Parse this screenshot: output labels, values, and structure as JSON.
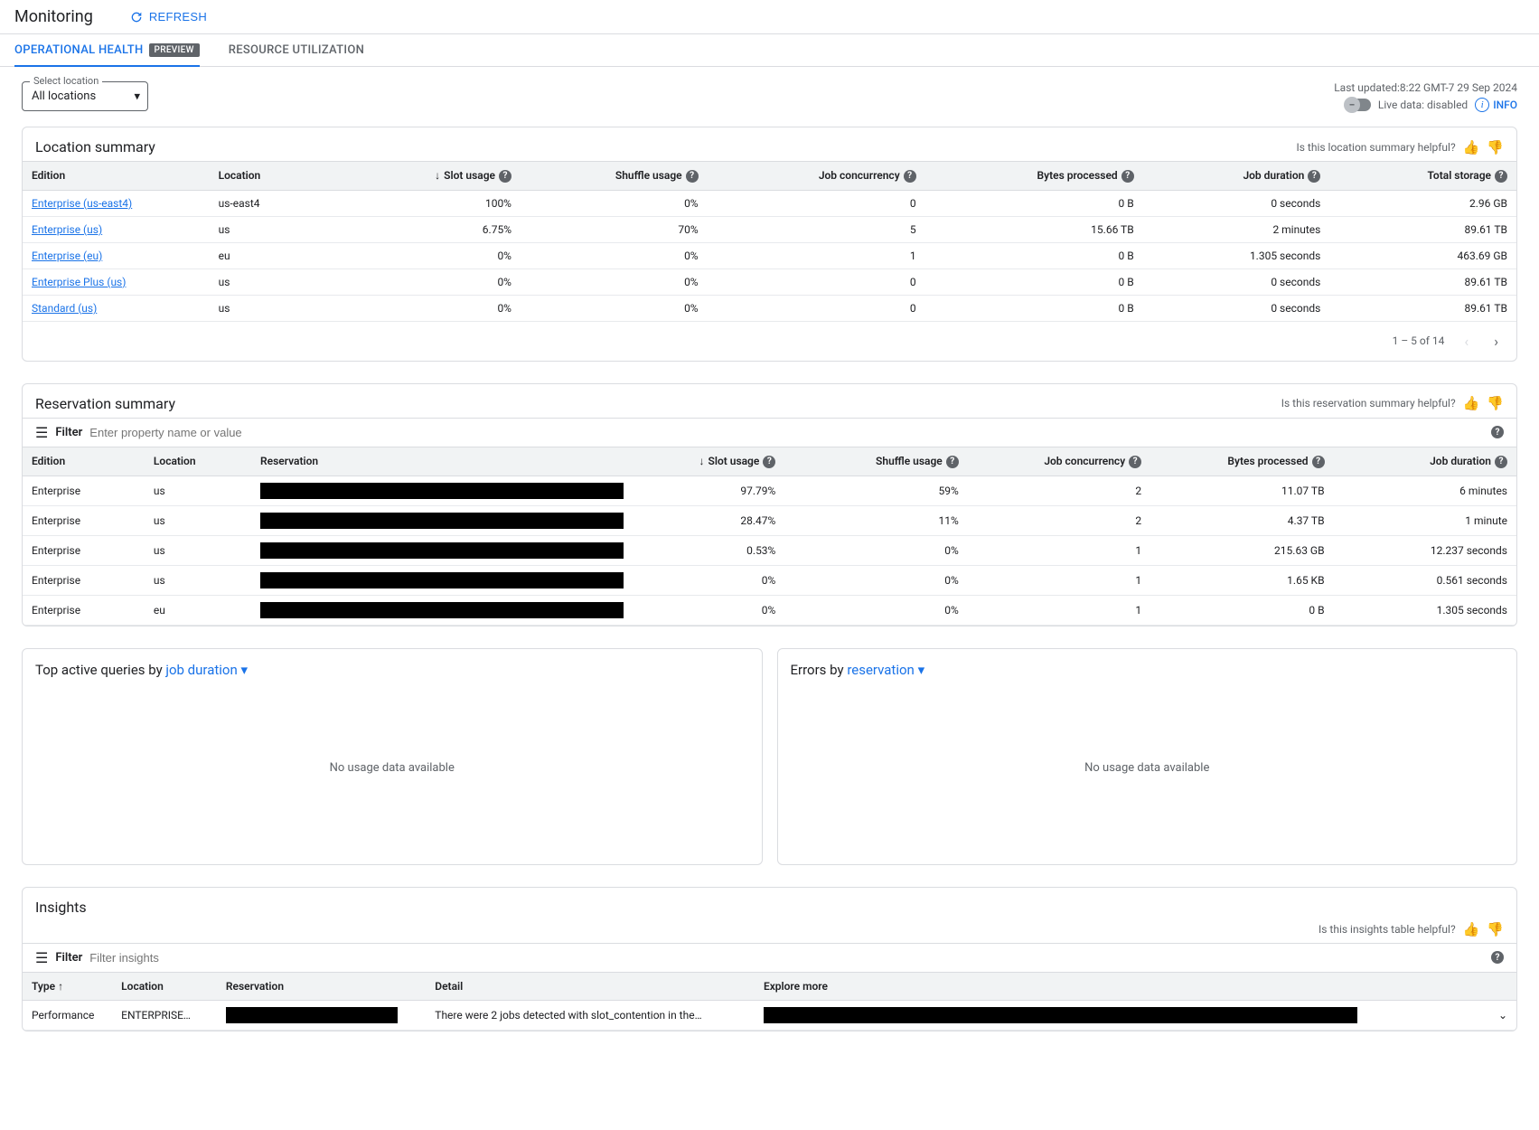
{
  "page_title": "Monitoring",
  "refresh_label": "REFRESH",
  "tabs": {
    "operational": "OPERATIONAL HEALTH",
    "preview_badge": "PREVIEW",
    "resource": "RESOURCE UTILIZATION"
  },
  "location_select": {
    "label": "Select location",
    "value": "All locations"
  },
  "last_updated_label": "Last updated:",
  "last_updated_value": "8:22 GMT-7 29 Sep 2024",
  "live_data_label": "Live data:",
  "live_data_status": "disabled",
  "info_label": "INFO",
  "location_summary": {
    "title": "Location summary",
    "helpful_prompt": "Is this location summary helpful?",
    "columns": {
      "edition": "Edition",
      "location": "Location",
      "slot_usage": "Slot usage",
      "shuffle_usage": "Shuffle usage",
      "job_concurrency": "Job concurrency",
      "bytes_processed": "Bytes processed",
      "job_duration": "Job duration",
      "total_storage": "Total storage"
    },
    "rows": [
      {
        "edition": "Enterprise (us-east4)",
        "location": "us-east4",
        "slot": "100%",
        "shuffle": "0%",
        "conc": "0",
        "bytes": "0 B",
        "dur": "0 seconds",
        "storage": "2.96 GB"
      },
      {
        "edition": "Enterprise (us)",
        "location": "us",
        "slot": "6.75%",
        "shuffle": "70%",
        "conc": "5",
        "bytes": "15.66 TB",
        "dur": "2 minutes",
        "storage": "89.61 TB"
      },
      {
        "edition": "Enterprise (eu)",
        "location": "eu",
        "slot": "0%",
        "shuffle": "0%",
        "conc": "1",
        "bytes": "0 B",
        "dur": "1.305 seconds",
        "storage": "463.69 GB"
      },
      {
        "edition": "Enterprise Plus (us)",
        "location": "us",
        "slot": "0%",
        "shuffle": "0%",
        "conc": "0",
        "bytes": "0 B",
        "dur": "0 seconds",
        "storage": "89.61 TB"
      },
      {
        "edition": "Standard (us)",
        "location": "us",
        "slot": "0%",
        "shuffle": "0%",
        "conc": "0",
        "bytes": "0 B",
        "dur": "0 seconds",
        "storage": "89.61 TB"
      }
    ],
    "pagination": "1 – 5 of 14"
  },
  "reservation_summary": {
    "title": "Reservation summary",
    "helpful_prompt": "Is this reservation summary helpful?",
    "filter_label": "Filter",
    "filter_placeholder": "Enter property name or value",
    "columns": {
      "edition": "Edition",
      "location": "Location",
      "reservation": "Reservation",
      "slot_usage": "Slot usage",
      "shuffle_usage": "Shuffle usage",
      "job_concurrency": "Job concurrency",
      "bytes_processed": "Bytes processed",
      "job_duration": "Job duration"
    },
    "rows": [
      {
        "edition": "Enterprise",
        "location": "us",
        "slot": "97.79%",
        "shuffle": "59%",
        "conc": "2",
        "bytes": "11.07 TB",
        "dur": "6 minutes"
      },
      {
        "edition": "Enterprise",
        "location": "us",
        "slot": "28.47%",
        "shuffle": "11%",
        "conc": "2",
        "bytes": "4.37 TB",
        "dur": "1 minute"
      },
      {
        "edition": "Enterprise",
        "location": "us",
        "slot": "0.53%",
        "shuffle": "0%",
        "conc": "1",
        "bytes": "215.63 GB",
        "dur": "12.237 seconds"
      },
      {
        "edition": "Enterprise",
        "location": "us",
        "slot": "0%",
        "shuffle": "0%",
        "conc": "1",
        "bytes": "1.65 KB",
        "dur": "0.561 seconds"
      },
      {
        "edition": "Enterprise",
        "location": "eu",
        "slot": "0%",
        "shuffle": "0%",
        "conc": "1",
        "bytes": "0 B",
        "dur": "1.305 seconds"
      }
    ]
  },
  "top_active": {
    "prefix": "Top active queries by ",
    "dropdown": "job duration",
    "empty": "No usage data available"
  },
  "errors_by": {
    "prefix": "Errors by ",
    "dropdown": "reservation",
    "empty": "No usage data available"
  },
  "insights": {
    "title": "Insights",
    "helpful_prompt": "Is this insights table helpful?",
    "filter_label": "Filter",
    "filter_placeholder": "Filter insights",
    "columns": {
      "type": "Type",
      "location": "Location",
      "reservation": "Reservation",
      "detail": "Detail",
      "explore": "Explore more"
    },
    "rows": [
      {
        "type": "Performance",
        "location": "ENTERPRISE…",
        "detail": "There were 2 jobs detected with slot_contention in the…"
      }
    ]
  }
}
